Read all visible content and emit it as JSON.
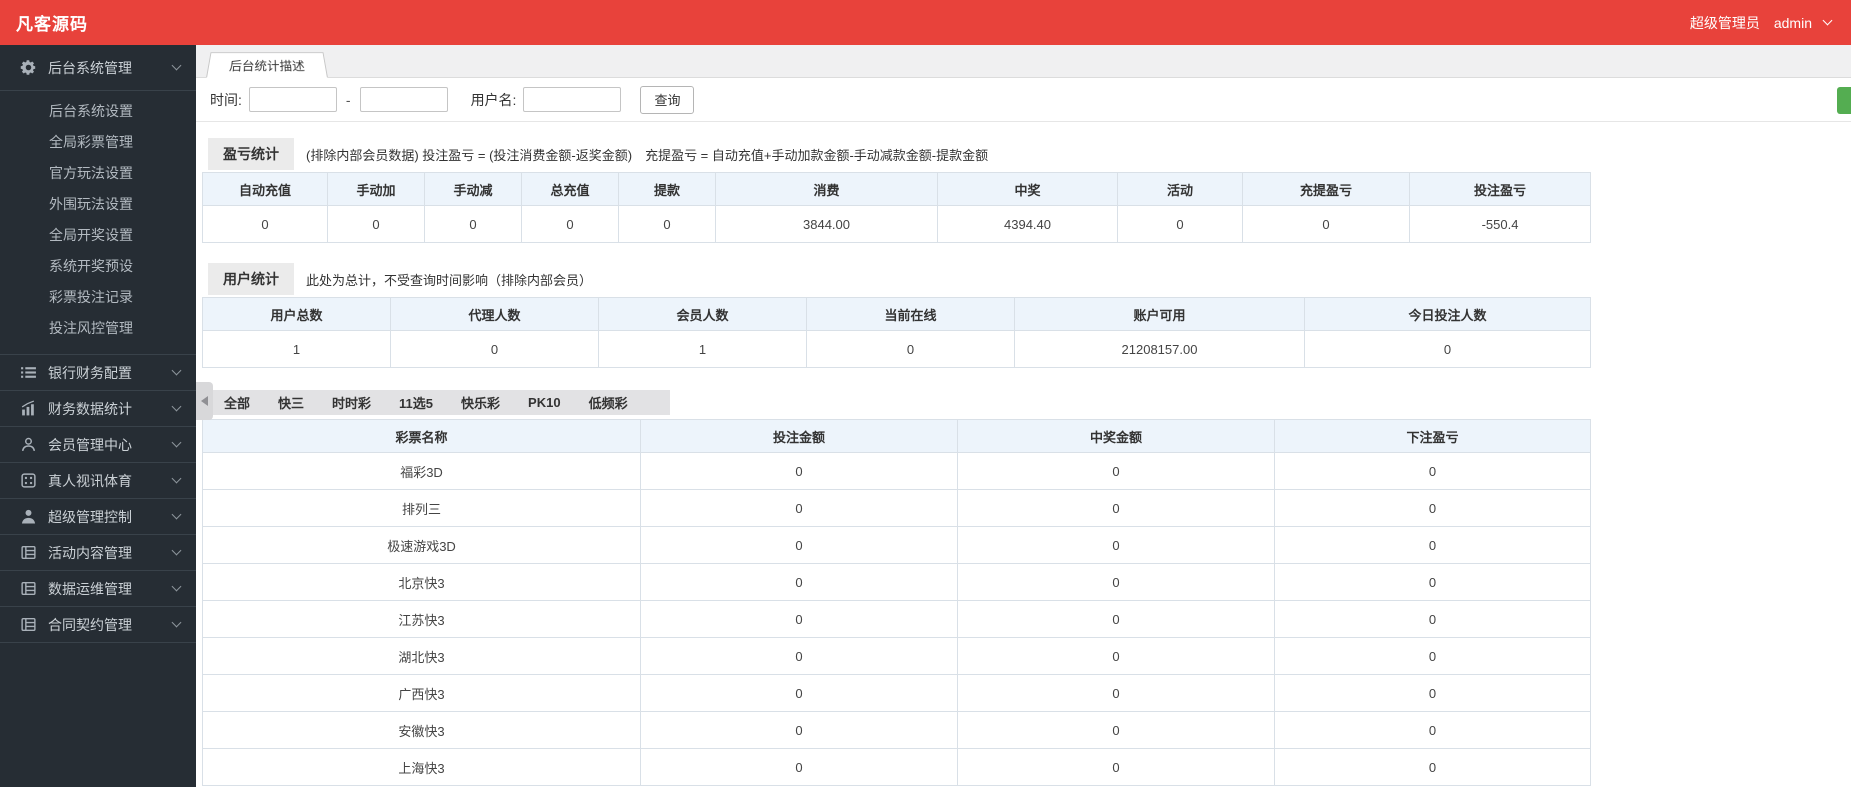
{
  "colors": {
    "header_bg": "#e8423b",
    "green_button": "#54ad51",
    "sidebar_bg": "#262d34",
    "table_header_bg": "#edf4fb"
  },
  "header": {
    "brand": "凡客源码",
    "role": "超级管理员",
    "username": "admin"
  },
  "sidebar": {
    "sections": [
      {
        "label": "后台系统管理",
        "icon": "gear-icon",
        "expanded": true,
        "children": [
          "后台系统设置",
          "全局彩票管理",
          "官方玩法设置",
          "外围玩法设置",
          "全局开奖设置",
          "系统开奖预设",
          "彩票投注记录",
          "投注风控管理"
        ]
      },
      {
        "label": "银行财务配置",
        "icon": "list-icon"
      },
      {
        "label": "财务数据统计",
        "icon": "chart-icon"
      },
      {
        "label": "会员管理中心",
        "icon": "user-outline-icon"
      },
      {
        "label": "真人视讯体育",
        "icon": "dice-icon"
      },
      {
        "label": "超级管理控制",
        "icon": "user-icon"
      },
      {
        "label": "活动内容管理",
        "icon": "panel-icon"
      },
      {
        "label": "数据运维管理",
        "icon": "panel-icon"
      },
      {
        "label": "合同契约管理",
        "icon": "panel-icon"
      }
    ]
  },
  "page_tab": {
    "title": "后台统计描述"
  },
  "search": {
    "time_label": "时间:",
    "separator": "-",
    "username_label": "用户名:",
    "query_button": "查询"
  },
  "profit_section": {
    "badge": "盈亏统计",
    "description": "(排除内部会员数据) 投注盈亏 = (投注消费金额-返奖金额)　充提盈亏 = 自动充值+手动加款金额-手动减款金额-提款金额",
    "columns": [
      "自动充值",
      "手动加",
      "手动减",
      "总充值",
      "提款",
      "消费",
      "中奖",
      "活动",
      "充提盈亏",
      "投注盈亏"
    ],
    "values": [
      "0",
      "0",
      "0",
      "0",
      "0",
      "3844.00",
      "4394.40",
      "0",
      "0",
      "-550.4"
    ]
  },
  "user_section": {
    "badge": "用户统计",
    "description": "此处为总计，不受查询时间影响（排除内部会员）",
    "columns": [
      "用户总数",
      "代理人数",
      "会员人数",
      "当前在线",
      "账户可用",
      "今日投注人数"
    ],
    "values": [
      "1",
      "0",
      "1",
      "0",
      "21208157.00",
      "0"
    ]
  },
  "lottery_tabs": [
    "全部",
    "快三",
    "时时彩",
    "11选5",
    "快乐彩",
    "PK10",
    "低频彩"
  ],
  "lottery_table": {
    "columns": [
      "彩票名称",
      "投注金额",
      "中奖金额",
      "下注盈亏"
    ],
    "rows": [
      [
        "福彩3D",
        "0",
        "0",
        "0"
      ],
      [
        "排列三",
        "0",
        "0",
        "0"
      ],
      [
        "极速游戏3D",
        "0",
        "0",
        "0"
      ],
      [
        "北京快3",
        "0",
        "0",
        "0"
      ],
      [
        "江苏快3",
        "0",
        "0",
        "0"
      ],
      [
        "湖北快3",
        "0",
        "0",
        "0"
      ],
      [
        "广西快3",
        "0",
        "0",
        "0"
      ],
      [
        "安徽快3",
        "0",
        "0",
        "0"
      ],
      [
        "上海快3",
        "0",
        "0",
        "0"
      ]
    ]
  }
}
